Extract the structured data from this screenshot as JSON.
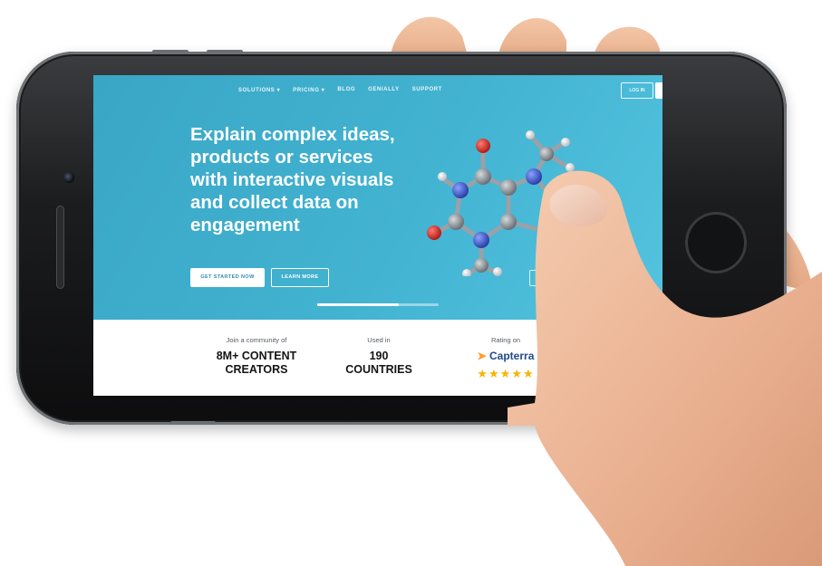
{
  "nav": {
    "items": [
      "SOLUTIONS ▾",
      "PRICING ▾",
      "BLOG",
      "GENIALLY",
      "SUPPORT"
    ],
    "login_label": "LOG IN"
  },
  "hero": {
    "headline_lines": [
      "Explain complex ideas,",
      "products or services",
      "with interactive visuals",
      "and collect data on",
      "engagement"
    ],
    "primary_button": "GET STARTED NOW",
    "secondary_button": "LEARN MORE",
    "slider_progress": 0.67
  },
  "stats": {
    "community": {
      "sub": "Join a community of",
      "line1": "8M+ CONTENT",
      "line2": "CREATORS"
    },
    "countries": {
      "sub": "Used in",
      "line1": "190",
      "line2": "COUNTRIES"
    },
    "rating": {
      "sub": "Rating on",
      "brand": "Capterra",
      "stars": "★★★★★"
    }
  },
  "colors": {
    "hero_bg": "#42b3d1",
    "accent_button_text": "#2e8fae",
    "star": "#f8b400",
    "capterra_blue": "#204a87",
    "oxygen_atom": "#e0302a",
    "nitrogen_atom": "#3d5fd1",
    "carbon_atom": "#8a9096"
  },
  "icons": {
    "capterra_logo": "capterra-arrow-icon",
    "next_slide": "chevron-right-icon"
  }
}
